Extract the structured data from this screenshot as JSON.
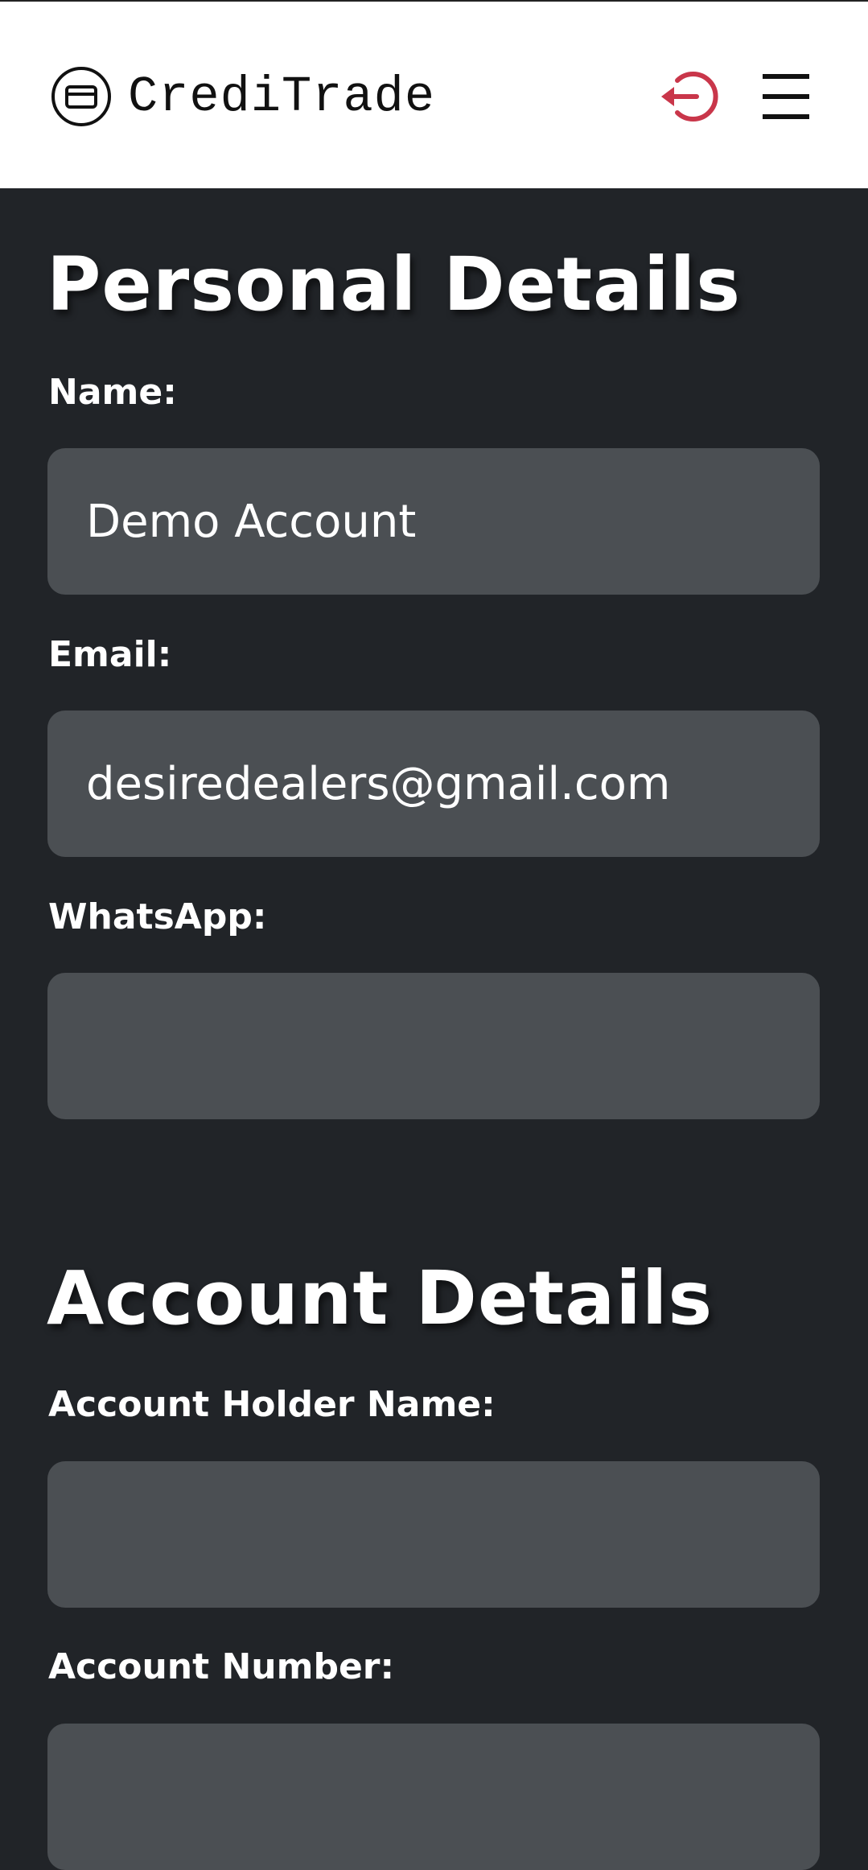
{
  "header": {
    "brand_name": "CrediTrade",
    "icons": {
      "logo": "credit-card-icon",
      "logout": "logout-icon",
      "menu": "hamburger-menu-icon"
    },
    "colors": {
      "logout": "#c9364a"
    }
  },
  "personal": {
    "title": "Personal Details",
    "name_label": "Name:",
    "name_value": "Demo Account",
    "email_label": "Email:",
    "email_value": "desiredealers@gmail.com",
    "whatsapp_label": "WhatsApp:",
    "whatsapp_value": ""
  },
  "account": {
    "title": "Account Details",
    "holder_label": "Account Holder Name:",
    "holder_value": "",
    "number_label": "Account Number:",
    "number_value": ""
  },
  "colors": {
    "background": "#212428",
    "input_bg": "#4b4f53",
    "header_bg": "#ffffff"
  }
}
